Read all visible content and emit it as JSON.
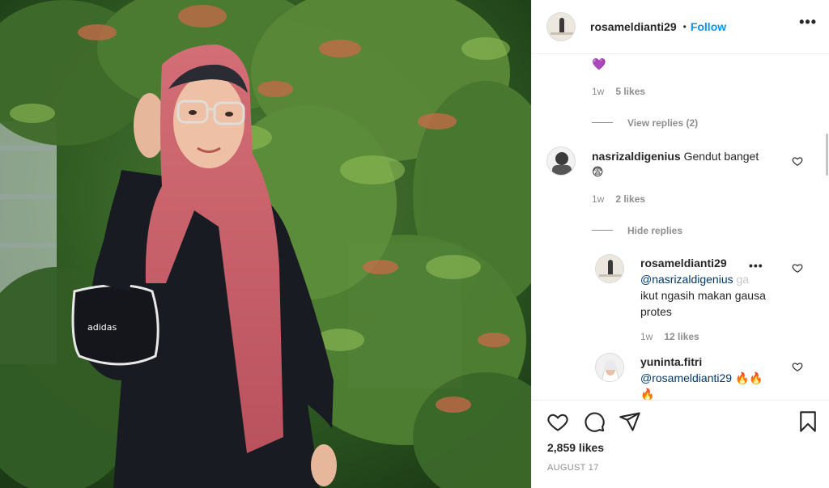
{
  "post": {
    "photo_alt": "",
    "likes": "2,859 likes",
    "date": "AUGUST 17"
  },
  "header": {
    "username": "rosameldianti29",
    "separator": "•",
    "follow_label": "Follow",
    "more_label": "•••"
  },
  "comments": {
    "first_partial": {
      "emoji": "💜",
      "time": "1w",
      "likes": "5 likes",
      "view_replies": "View replies (2)"
    },
    "second": {
      "username": "nasrizaldigenius",
      "text": "Gendut banget",
      "emoji": "😨",
      "time": "1w",
      "likes": "2 likes",
      "hide_replies": "Hide replies"
    },
    "reply1": {
      "username": "rosameldianti29",
      "mention": "@nasrizaldigenius",
      "text_after_mention": "ga",
      "text_line2": "ikut ngasih makan gausa",
      "text_line3": "protes",
      "time": "1w",
      "likes": "12 likes",
      "more_label": "•••"
    },
    "reply2": {
      "username": "yuninta.fitri",
      "mention": "@rosameldianti29",
      "emoji": "🔥🔥",
      "emoji_line2": "🔥"
    }
  },
  "icons": {
    "like": "heart-outline-icon",
    "comment": "comment-bubble-icon",
    "share": "paper-plane-icon",
    "save": "bookmark-icon"
  },
  "colors": {
    "follow_blue": "#0095f6",
    "mention_blue": "#00376b",
    "muted_gray": "#8e8e8e",
    "text_dark": "#262626",
    "hijab_pink": "#c9606a"
  }
}
